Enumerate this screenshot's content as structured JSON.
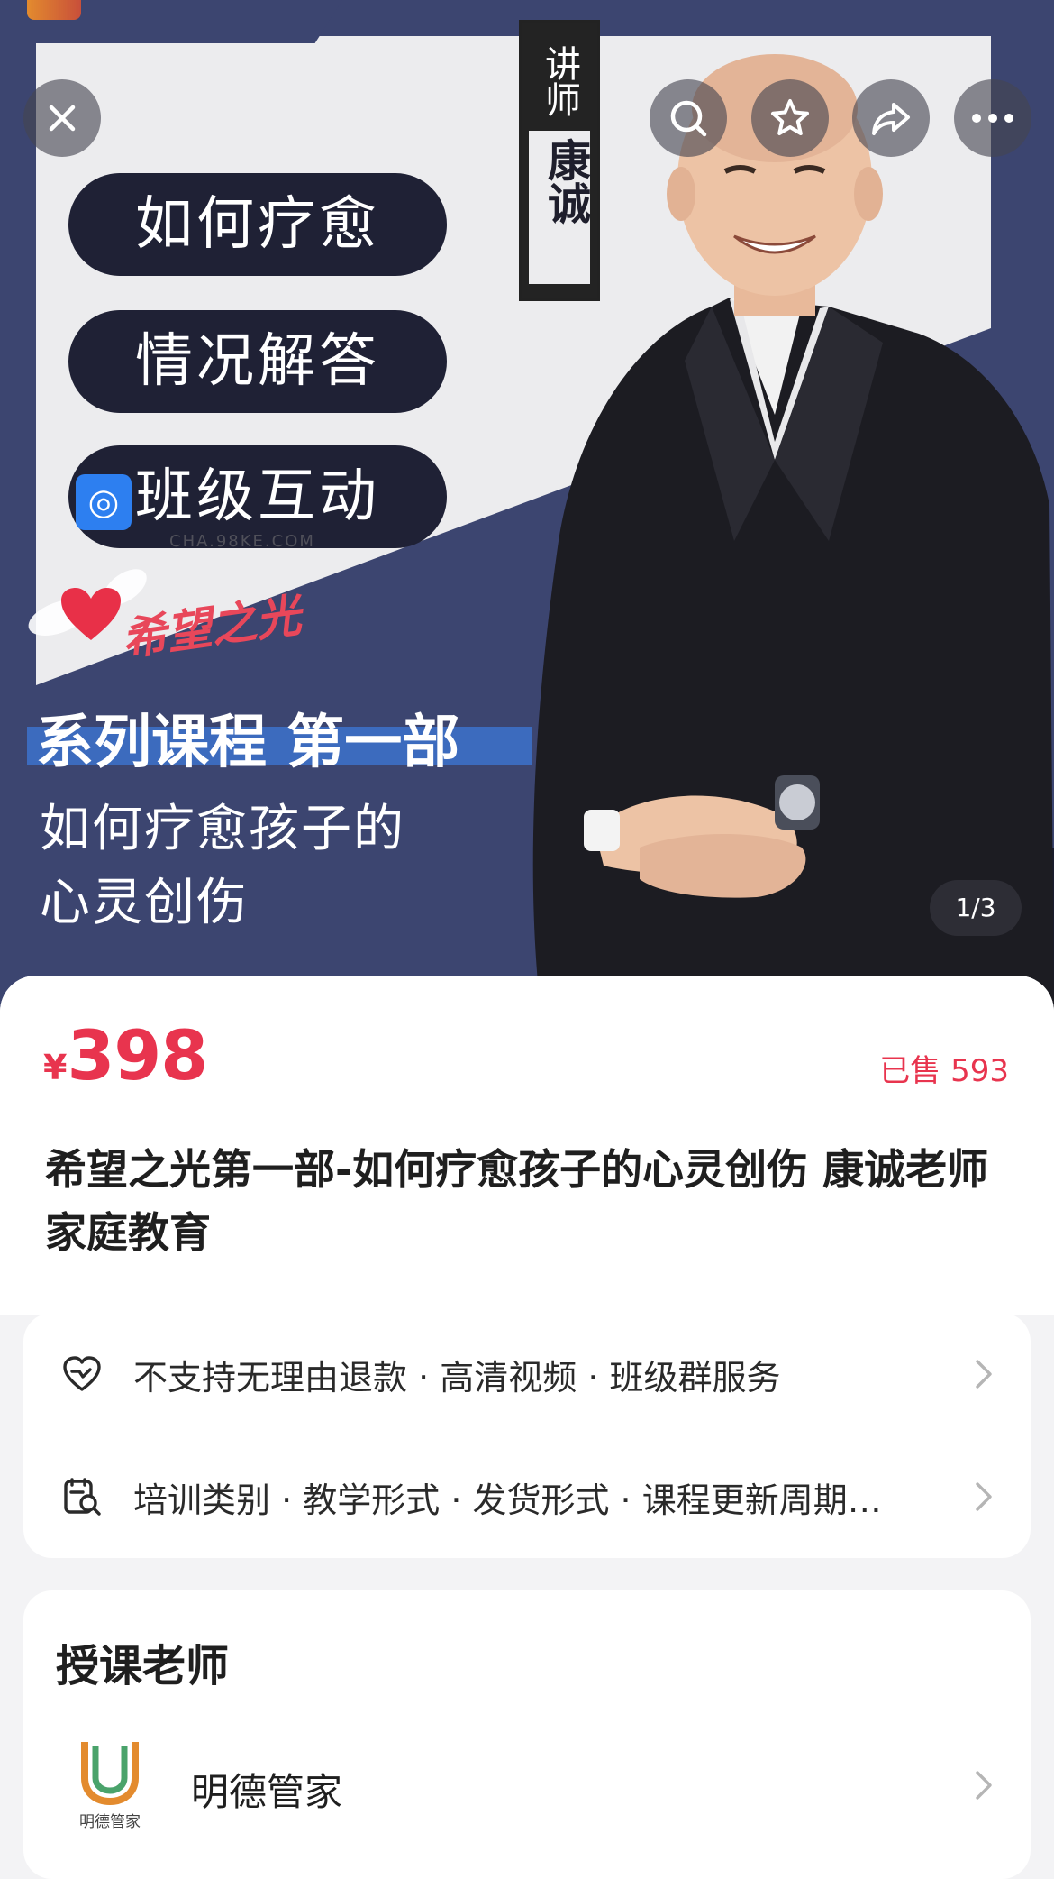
{
  "hero": {
    "lecturer_label": "讲师",
    "lecturer_name": "康诚",
    "pill_1": "如何疗愈",
    "pill_2": "情况解答",
    "pill_3": "班级互动",
    "watermark_url": "CHA.98KE.COM",
    "brand_script": "希望之光",
    "series_title": "系列课程 第一部",
    "subtitle_line1": "如何疗愈孩子的",
    "subtitle_line2": "心灵创伤",
    "pager": "1/3"
  },
  "toolbar": {
    "close_icon": "close-icon",
    "search_icon": "search-icon",
    "favorite_icon": "star-icon",
    "share_icon": "share-icon",
    "more_icon": "more-icon"
  },
  "product": {
    "currency": "¥",
    "price": "398",
    "sold": "已售 593",
    "title": "希望之光第一部-如何疗愈孩子的心灵创伤 康诚老师家庭教育"
  },
  "info": {
    "row1": "不支持无理由退款 · 高清视频 · 班级群服务",
    "row2": "培训类别 · 教学形式 · 发货形式 · 课程更新周期…"
  },
  "teacher": {
    "section_title": "授课老师",
    "name": "明德管家",
    "logo_text": "明德管家"
  },
  "colors": {
    "accent": "#e8344e",
    "hero_dark": "#3c4570",
    "pill": "#1f2135"
  }
}
